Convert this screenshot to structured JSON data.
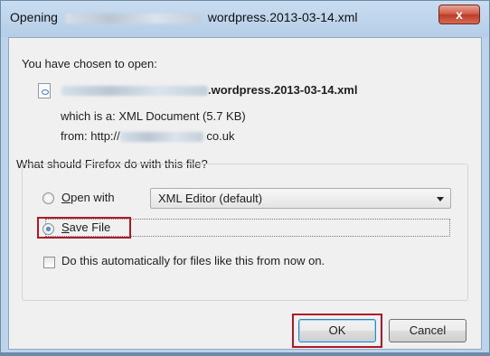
{
  "window": {
    "title_prefix": "Opening",
    "title_suffix": "wordpress.2013-03-14.xml",
    "close_label": "x"
  },
  "intro": "You have chosen to open:",
  "file": {
    "name_suffix": ".wordpress.2013-03-14.xml",
    "which_label": "which is a:",
    "type": "XML Document (5.7 KB)",
    "from_label": "from:",
    "from_prefix": "http://",
    "from_suffix": "co.uk"
  },
  "question": "What should Firefox do with this file?",
  "options": {
    "open_with_label": "Open with",
    "open_with_app": "XML Editor (default)",
    "open_with_selected": false,
    "save_file_label": "Save File",
    "save_file_selected": true,
    "auto_label": "Do this automatically for files like this from now on.",
    "auto_checked": false
  },
  "buttons": {
    "ok": "OK",
    "cancel": "Cancel"
  },
  "colors": {
    "highlight": "#b0182a",
    "close_button": "#c7432f"
  }
}
